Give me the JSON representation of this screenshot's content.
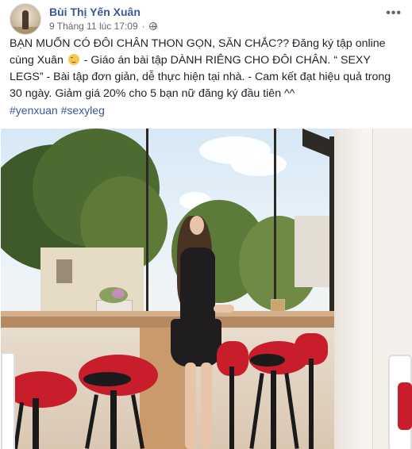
{
  "post": {
    "author": "Bùi Thị Yến Xuân",
    "timestamp": "9 Tháng 11 lúc 17:09",
    "separator": "·",
    "more_label": "•••",
    "text_part1": "BẠN MUỐN CÓ ĐÔI CHÂN THON GỌN, SĂN CHẮC?? Đăng ký tập online cùng Xuân",
    "text_part2": " - Giáo án bài tập DÀNH RIÊNG CHO ĐÔI CHÂN. “ SEXY LEGS” - Bài tập đơn giản, dễ thực hiện tại nhà. - Cam kết đạt hiệu quả trong 30 ngày. Giảm giá 20% cho 5 bạn nữ đăng ký đầu tiên ^^",
    "hashtags": [
      "#yenxuan",
      "#sexyleg"
    ],
    "icons": {
      "avatar": "profile-avatar",
      "privacy": "globe-icon",
      "emoji": "smirk-emoji-icon",
      "more": "more-options-icon"
    },
    "colors": {
      "link": "#385898",
      "text": "#1d2129",
      "meta": "#616770",
      "stool_red": "#c81e2c"
    }
  }
}
